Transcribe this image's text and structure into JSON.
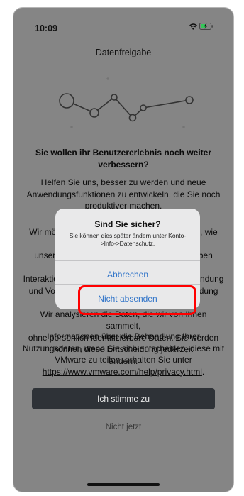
{
  "status_bar": {
    "time": "10:09",
    "signal": "....",
    "icons": [
      "wifi-icon",
      "battery-charging-icon"
    ]
  },
  "nav": {
    "title": "Datenfreigabe"
  },
  "content": {
    "heading": "Sie wollen ihr Benutzererlebnis noch weiter verbessern?",
    "paragraph1": "Helfen Sie uns, besser zu werden und neue Anwendungsfunktionen zu entwickeln, die Sie noch produktiver machen.",
    "paragraph2_lines": [
      "Wir möchten Informationen darüber sammeln, wie Sie und Ihre Kollegen",
      "unsere Anwendung nutzen. Diese Daten geben Aufschluss über die",
      "Interaktionen mit der Anwendung, deren Verwendung",
      "und Vorschläge zur Verbesserung der Anwendung führen.",
      "Wir analysieren die Daten, die wir von Ihnen sammelt,",
      "ohne persönlich identifizierbare Daten. Sie werden",
      "können diese Entscheidung jederzeit",
      "ändern."
    ],
    "paragraph3": "Informationen über die Behandlung Ihrer Nutzungsdaten, wenn Sie sich entscheiden, diese mit VMware zu teilen, erhalten Sie unter",
    "privacy_link": "https://www.vmware.com/help/privacy.html",
    "privacy_link_suffix": ".",
    "agree_button": "Ich stimme zu",
    "not_now_button": "Nicht jetzt"
  },
  "alert": {
    "title": "Sind Sie sicher?",
    "message": "Sie können dies später ändern unter Konto->Info->Datenschutz.",
    "cancel_button": "Abbrechen",
    "confirm_button": "Nicht absenden"
  },
  "colors": {
    "accent": "#2f73c8",
    "highlight": "#ff0000",
    "primary_button": "#2e3237"
  }
}
